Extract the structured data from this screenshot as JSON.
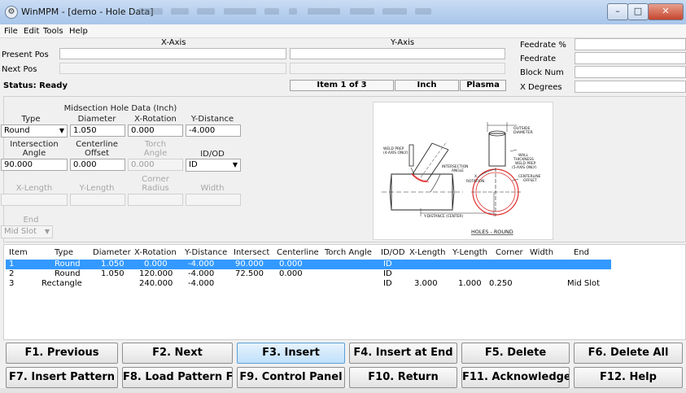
{
  "window": {
    "title": "WinMPM - [demo - Hole Data]",
    "app_icon": "gear-icon"
  },
  "menu": [
    "File",
    "Edit",
    "Tools",
    "Help"
  ],
  "position": {
    "x_axis_label": "X-Axis",
    "y_axis_label": "Y-Axis",
    "present_label": "Present Pos",
    "next_label": "Next Pos"
  },
  "status": {
    "text": "Status: Ready",
    "item": "Item 1 of 3",
    "unit": "Inch",
    "process": "Plasma"
  },
  "right_fields": [
    "Feedrate %",
    "Feedrate",
    "Block Num",
    "X Degrees"
  ],
  "form": {
    "section_title": "Midsection Hole Data (Inch)",
    "type_label": "Type",
    "type_value": "Round",
    "diameter_label": "Diameter",
    "diameter_value": "1.050",
    "xrot_label": "X-Rotation",
    "xrot_value": "0.000",
    "ydist_label": "Y-Distance",
    "ydist_value": "-4.000",
    "intersection_label_1": "Intersection",
    "intersection_label_2": "Angle",
    "intersection_value": "90.000",
    "centerline_label_1": "Centerline",
    "centerline_label_2": "Offset",
    "centerline_value": "0.000",
    "torch_label_1": "Torch",
    "torch_label_2": "Angle",
    "torch_value": "0.000",
    "idod_label": "ID/OD",
    "idod_value": "ID",
    "xlength_label": "X-Length",
    "ylength_label": "Y-Length",
    "corner_label_1": "Corner",
    "corner_label_2": "Radius",
    "width_label": "Width",
    "end_label": "End",
    "end_value": "Mid Slot"
  },
  "diagram": {
    "outside_diameter": "OUTSIDE\nDIAMETER",
    "weld_prep_left": "WELD PREP\n(4-AXIS ONLY)",
    "wall_thickness": "WALL\nTHICKNESS",
    "weld_prep_right": "WELD PREP\n(5-AXIS ONLY)",
    "intersection_angle": "INTERSECTION\nANGLE",
    "x_rotation": "X\nROTATION",
    "centerline_offset": "CENTERLINE\nOFFSET",
    "y_distance": "Y-DISTANCE (CENTER)",
    "caption": "HOLES - ROUND"
  },
  "table": {
    "headers": [
      "Item",
      "Type",
      "Diameter",
      "X-Rotation",
      "Y-Distance",
      "Intersect",
      "Centerline",
      "Torch Angle",
      "ID/OD",
      "X-Length",
      "Y-Length",
      "Corner",
      "Width",
      "End"
    ],
    "rows": [
      [
        "1",
        "Round",
        "1.050",
        "0.000",
        "-4.000",
        "90.000",
        "0.000",
        "",
        "ID",
        "",
        "",
        "",
        "",
        ""
      ],
      [
        "2",
        "Round",
        "1.050",
        "120.000",
        "-4.000",
        "72.500",
        "0.000",
        "",
        "ID",
        "",
        "",
        "",
        "",
        ""
      ],
      [
        "3",
        "Rectangle",
        "",
        "240.000",
        "-4.000",
        "",
        "",
        "",
        "ID",
        "3.000",
        "1.000",
        "0.250",
        "",
        "Mid Slot"
      ]
    ],
    "selected_row": 0
  },
  "fkeys": [
    [
      "F1. Previous",
      "F2. Next",
      "F3. Insert",
      "F4. Insert at End",
      "F5. Delete",
      "F6. Delete All"
    ],
    [
      "F7. Insert Pattern",
      "F8. Load Pattern File",
      "F9. Control Panel",
      "F10. Return",
      "F11. Acknowledge",
      "F12. Help"
    ]
  ],
  "colors": {
    "selection": "#3399ff",
    "title_gradient_top": "#c9dcf3",
    "close_button": "#c6462f",
    "diagram_circle": "#e03030"
  }
}
